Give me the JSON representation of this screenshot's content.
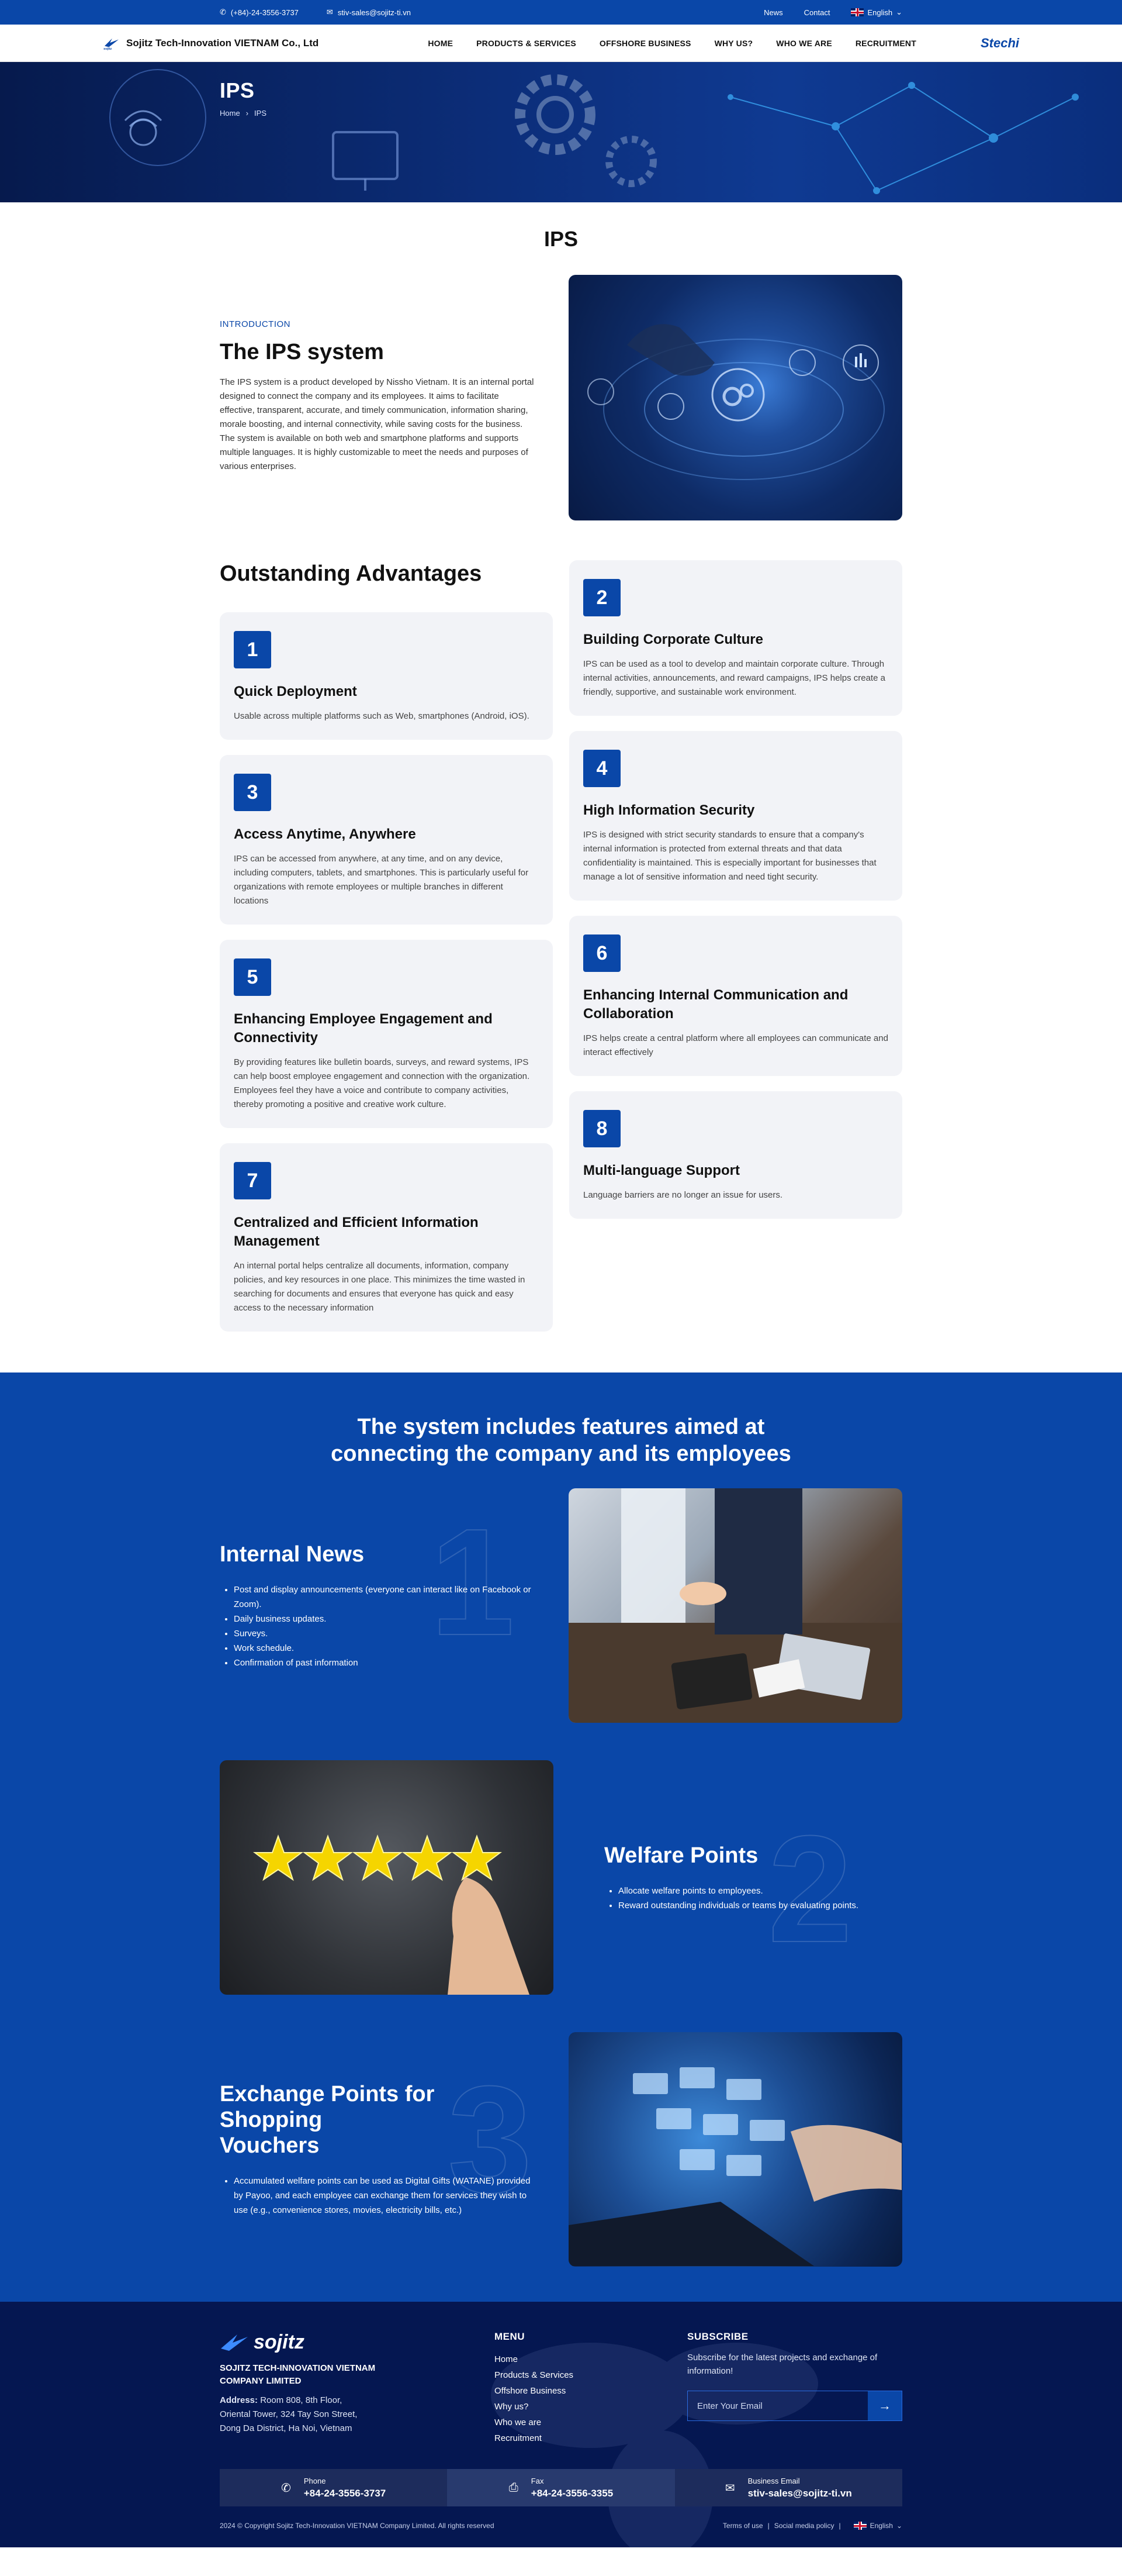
{
  "topbar": {
    "phone": "(+84)-24-3556-3737",
    "email": "stiv-sales@sojitz-ti.vn",
    "links": [
      "News",
      "Contact"
    ],
    "language": "English"
  },
  "nav": {
    "company": "Sojitz Tech-Innovation VIETNAM Co., Ltd",
    "logo_small": "sojitz",
    "items": [
      "HOME",
      "PRODUCTS & SERVICES",
      "OFFSHORE BUSINESS",
      "WHY US?",
      "WHO WE ARE",
      "RECRUITMENT"
    ],
    "partner_logo": "Stechi"
  },
  "hero": {
    "title": "IPS",
    "breadcrumb": [
      "Home",
      "IPS"
    ]
  },
  "page_title": "IPS",
  "intro": {
    "eyebrow": "INTRODUCTION",
    "heading": "The IPS system",
    "body": "The IPS system is a product developed by Nissho Vietnam. It is an internal portal designed to connect the company and its employees. It aims to facilitate effective, transparent, accurate, and timely communication, information sharing, morale boosting, and internal connectivity, while saving costs for the business. The system is available on both web and smartphone platforms and supports multiple languages. It is highly customizable to meet the needs and purposes of various enterprises."
  },
  "advantages": {
    "heading": "Outstanding Advantages",
    "left": [
      {
        "num": "1",
        "title": "Quick Deployment",
        "text": "Usable across multiple platforms such as Web, smartphones (Android, iOS)."
      },
      {
        "num": "3",
        "title": "Access Anytime, Anywhere",
        "text": "IPS can be accessed from anywhere, at any time, and on any device, including computers, tablets, and smartphones. This is particularly useful for organizations with remote employees or multiple branches in different locations"
      },
      {
        "num": "5",
        "title": "Enhancing Employee Engagement and Connectivity",
        "text": "By providing features like bulletin boards, surveys, and reward systems, IPS can help boost employee engagement and connection with the organization. Employees feel they have a voice and contribute to company activities, thereby promoting a positive and creative work culture."
      },
      {
        "num": "7",
        "title": "Centralized and Efficient Information Management",
        "text": "An internal portal helps centralize all documents, information, company policies, and key resources in one place. This minimizes the time wasted in searching for documents and ensures that everyone has quick and easy access to the necessary information"
      }
    ],
    "right": [
      {
        "num": "2",
        "title": "Building Corporate Culture",
        "text": "IPS can be used as a tool to develop and maintain corporate culture. Through internal activities, announcements, and reward campaigns, IPS helps create a friendly, supportive, and sustainable work environment."
      },
      {
        "num": "4",
        "title": "High Information Security",
        "text": "IPS is designed with strict security standards to ensure that a company's internal information is protected from external threats and that data confidentiality is maintained. This is especially important for businesses that manage a lot of sensitive information and need tight security."
      },
      {
        "num": "6",
        "title": "Enhancing Internal Communication and Collaboration",
        "text": "IPS helps create a central platform where all employees can communicate and interact effectively"
      },
      {
        "num": "8",
        "title": "Multi-language Support",
        "text": "Language barriers are no longer an issue for users."
      }
    ]
  },
  "features": {
    "heading_line1": "The system includes features aimed at",
    "heading_line2": "connecting the company and its employees",
    "f1": {
      "num": "1",
      "title": "Internal News",
      "items": [
        "Post and display announcements (everyone can interact like on Facebook or Zoom).",
        "Daily business updates.",
        "Surveys.",
        "Work schedule.",
        "Confirmation of past information"
      ]
    },
    "f2": {
      "num": "2",
      "title": "Welfare Points",
      "items": [
        "Allocate welfare points to employees.",
        "Reward outstanding individuals or teams by evaluating points."
      ]
    },
    "f3": {
      "num": "3",
      "title_line1": "Exchange Points for Shopping",
      "title_line2": "Vouchers",
      "items": [
        "Accumulated welfare points can be used as Digital Gifts (WATANE) provided by Payoo, and each employee can exchange them for services they wish to use (e.g., convenience stores, movies, electricity bills, etc.)"
      ]
    }
  },
  "footer": {
    "logo": "sojitz",
    "company_line1": "SOJITZ TECH-INNOVATION VIETNAM",
    "company_line2": "COMPANY LIMITED",
    "address_label": "Address:",
    "address_1": "Room 808, 8th Floor,",
    "address_2": "Oriental Tower, 324 Tay Son Street,",
    "address_3": "Dong Da District, Ha Noi, Vietnam",
    "menu_title": "MENU",
    "menu": [
      "Home",
      "Products & Services",
      "Offshore Business",
      "Why us?",
      "Who we are",
      "Recruitment"
    ],
    "subscribe_title": "SUBSCRIBE",
    "subscribe_text": "Subscribe for the latest projects and exchange of information!",
    "email_placeholder": "Enter Your Email",
    "phone_label": "Phone",
    "phone": "+84-24-3556-3737",
    "fax_label": "Fax",
    "fax": "+84-24-3556-3355",
    "email_label": "Business Email",
    "email": "stiv-sales@sojitz-ti.vn",
    "copyright": "2024 © Copyright Sojitz Tech-Innovation VIETNAM Company Limited. All rights reserved",
    "terms": "Terms of use",
    "social": "Social media policy",
    "language": "English"
  },
  "colors": {
    "brand": "#0a47a8",
    "footer": "#051751",
    "card": "#f2f3f7"
  }
}
